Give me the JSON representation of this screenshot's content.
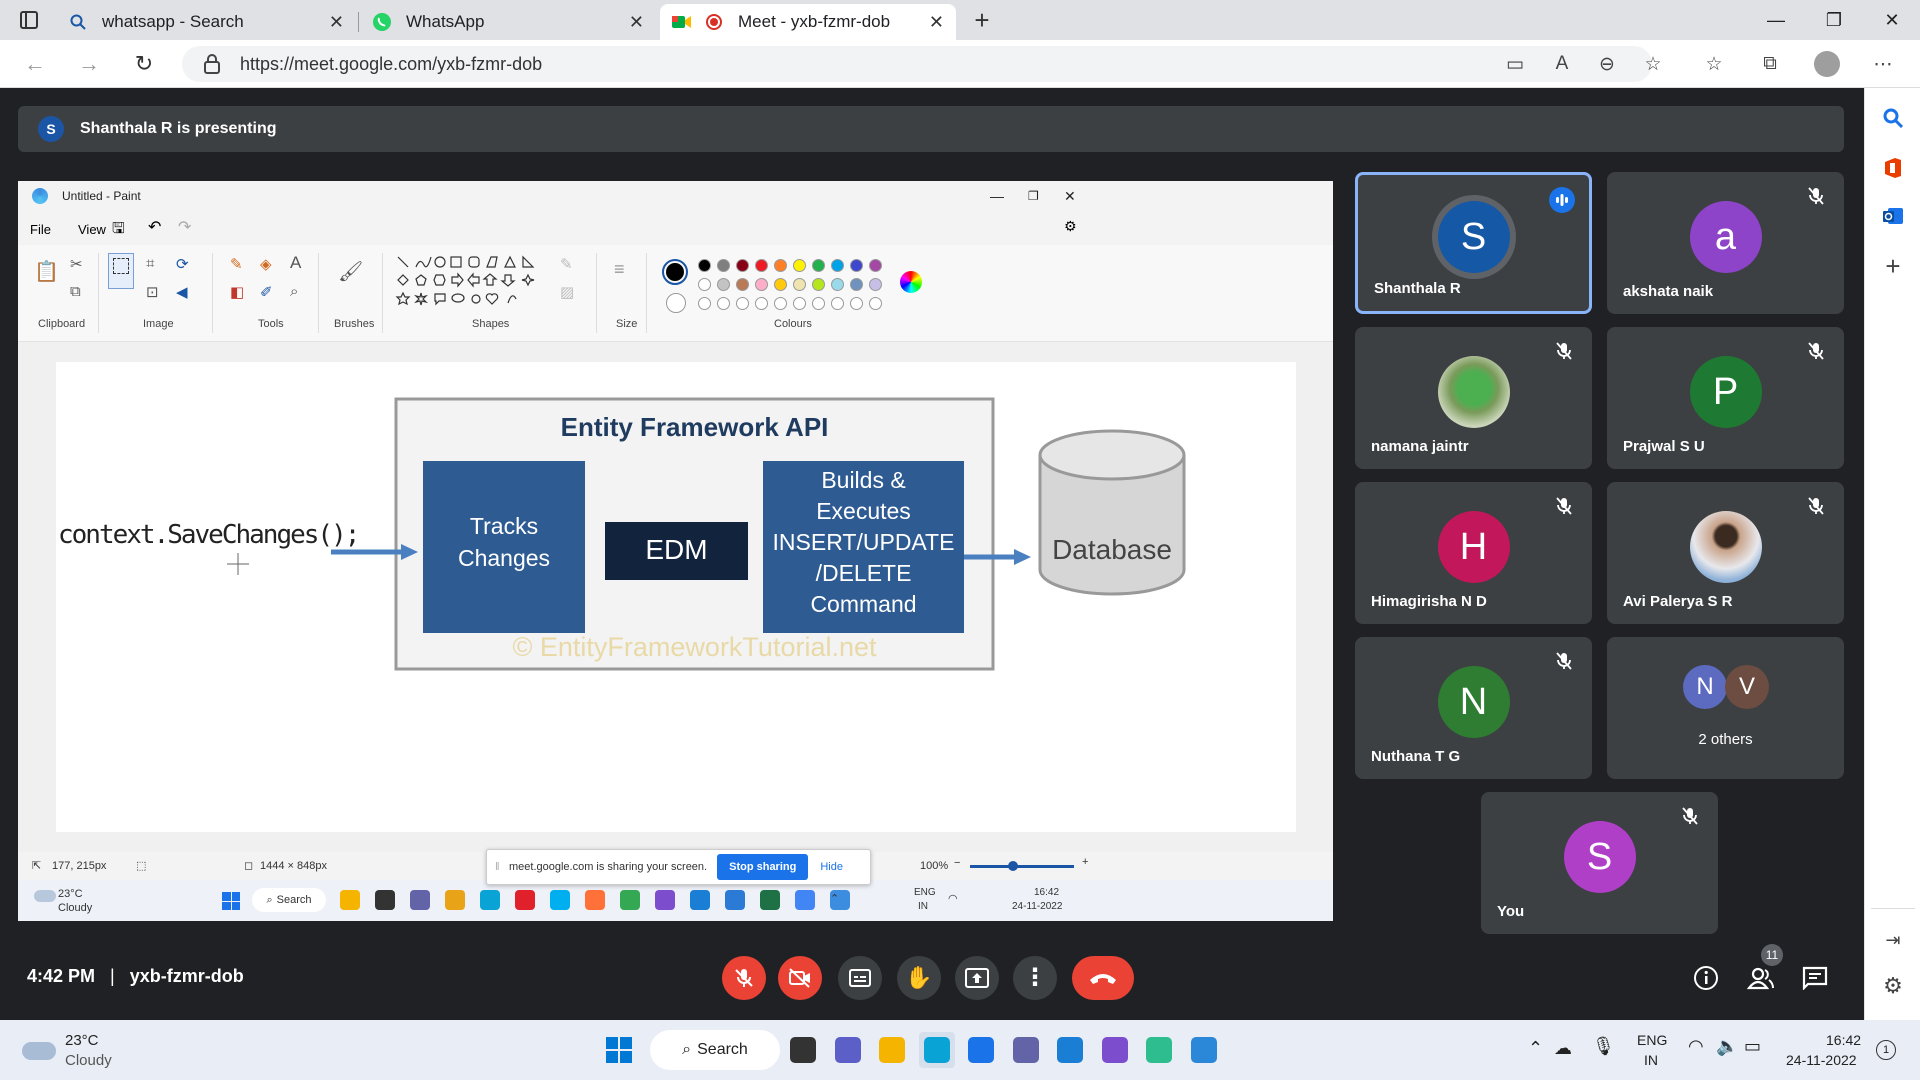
{
  "browser": {
    "tabs": [
      {
        "title": "whatsapp - Search",
        "icon": "search-icon"
      },
      {
        "title": "WhatsApp",
        "icon": "whatsapp-icon"
      },
      {
        "title": "Meet - yxb-fzmr-dob",
        "icon": "meet-icon",
        "active": true
      }
    ],
    "url": "https://meet.google.com/yxb-fzmr-dob"
  },
  "meet": {
    "presenter_initial": "S",
    "presenting_text": "Shanthala R is presenting",
    "time": "4:42 PM",
    "separator": "|",
    "meeting_code": "yxb-fzmr-dob",
    "participant_count": "11",
    "participants": [
      {
        "name": "Shanthala R",
        "initial": "S",
        "color": "#1558a6",
        "speaking": true
      },
      {
        "name": "akshata naik",
        "initial": "a",
        "color": "#8e44c9",
        "muted": true
      },
      {
        "name": "namana jaintr",
        "initial": "",
        "photo": "plant-photo",
        "muted": true
      },
      {
        "name": "Prajwal S U",
        "initial": "P",
        "color": "#1e7a33",
        "muted": true
      },
      {
        "name": "Himagirisha N D",
        "initial": "H",
        "color": "#c2185b",
        "muted": true
      },
      {
        "name": "Avi Palerya S R",
        "initial": "",
        "photo": "person-photo",
        "muted": true
      },
      {
        "name": "Nuthana T G",
        "initial": "N",
        "color": "#2e7d32",
        "muted": true
      },
      {
        "name": "2 others",
        "initials": [
          "N",
          "V"
        ],
        "colors": [
          "#5c6bc0",
          "#6d4c41"
        ]
      },
      {
        "name": "You",
        "initial": "S",
        "color": "#b03fc8",
        "muted": true
      }
    ]
  },
  "paint": {
    "title": "Untitled - Paint",
    "menu": [
      "File",
      "View"
    ],
    "groups": [
      "Clipboard",
      "Image",
      "Tools",
      "Brushes",
      "Shapes",
      "Size",
      "Colours"
    ],
    "palette_row1": [
      "#000000",
      "#7f7f7f",
      "#880015",
      "#ed1c24",
      "#ff7f27",
      "#fff200",
      "#22b14c",
      "#00a2e8",
      "#3f48cc",
      "#a349a4"
    ],
    "palette_row2": [
      "#ffffff",
      "#c3c3c3",
      "#b97a57",
      "#ffaec9",
      "#ffc90e",
      "#efe4b0",
      "#b5e61d",
      "#99d9ea",
      "#7092be",
      "#c8bfe7"
    ],
    "status_pos": "177, 215px",
    "status_size": "1444 × 848px",
    "zoom": "100%",
    "diagram": {
      "code": "context.SaveChanges();",
      "api_title": "Entity Framework API",
      "box1": [
        "Tracks",
        "Changes"
      ],
      "edm": "EDM",
      "box2": [
        "Builds &",
        "Executes",
        "INSERT/UPDATE",
        "/DELETE",
        "Command"
      ],
      "db": "Database",
      "watermark": "© EntityFrameworkTutorial.net"
    },
    "share_banner": {
      "text": "meet.google.com is sharing your screen.",
      "stop": "Stop sharing",
      "hide": "Hide"
    },
    "inner_taskbar": {
      "temp": "23°C",
      "weather": "Cloudy",
      "search": "Search",
      "lang1": "ENG",
      "lang2": "IN",
      "time": "16:42",
      "date": "24-11-2022"
    }
  },
  "taskbar": {
    "temp": "23°C",
    "weather": "Cloudy",
    "search": "Search",
    "lang1": "ENG",
    "lang2": "IN",
    "time": "16:42",
    "date": "24-11-2022",
    "notif": "1"
  }
}
